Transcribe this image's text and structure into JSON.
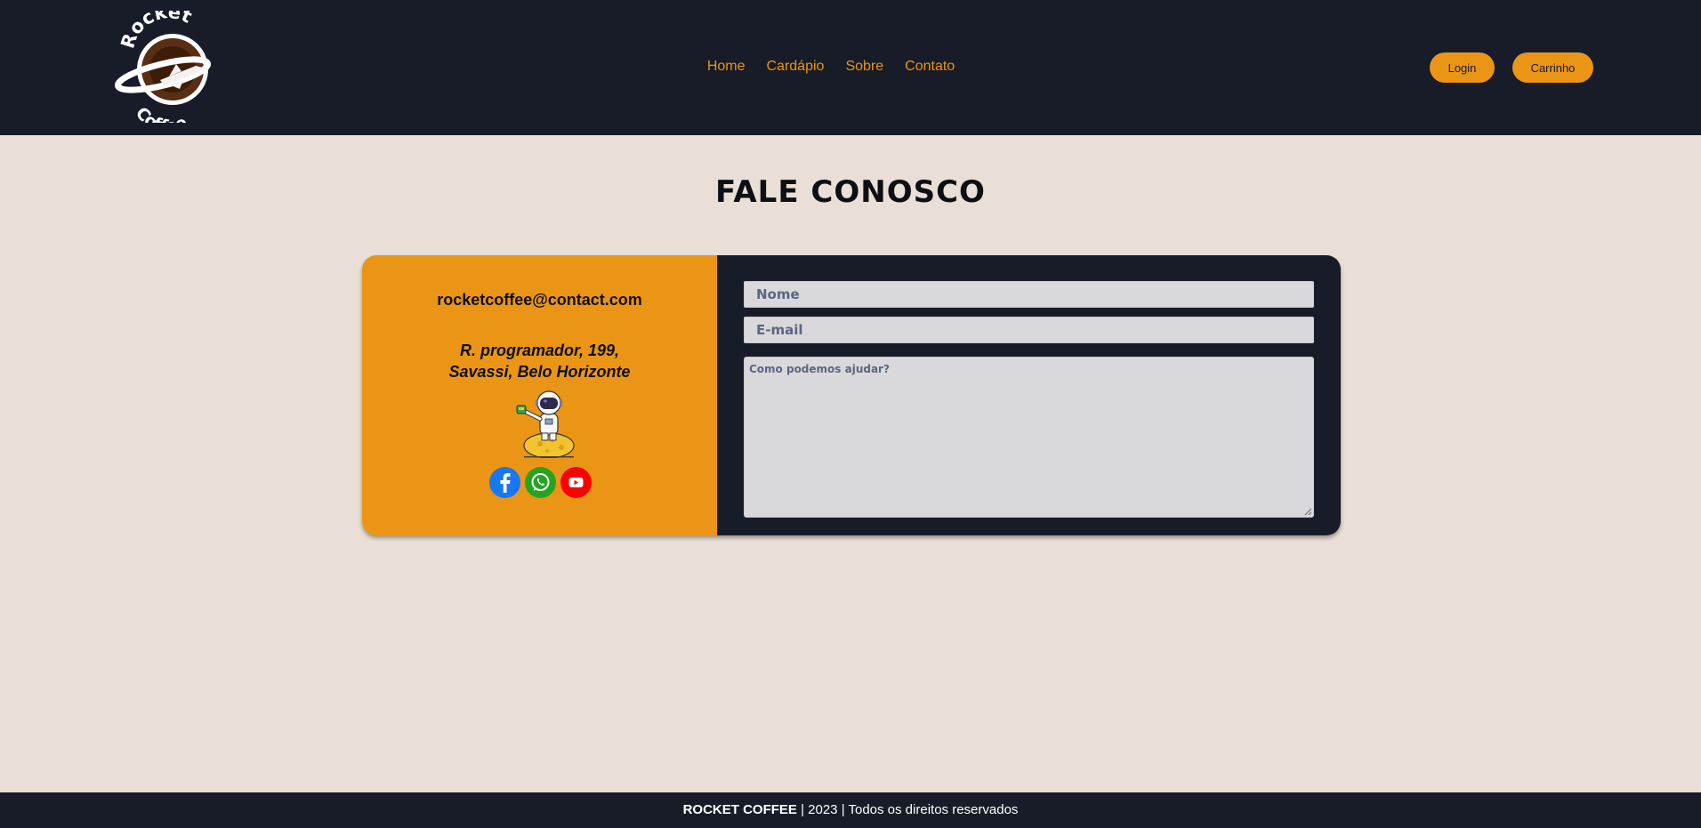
{
  "header": {
    "logo": {
      "top_text": "Rocket",
      "bottom_text": "Coffee",
      "icon": "rocket-coffee-cup-logo"
    },
    "nav": [
      {
        "label": "Home"
      },
      {
        "label": "Cardápio"
      },
      {
        "label": "Sobre"
      },
      {
        "label": "Contato"
      }
    ],
    "login_label": "Login",
    "cart_label": "Carrinho"
  },
  "main": {
    "title": "FALE CONOSCO",
    "contact": {
      "email": "rocketcoffee@contact.com",
      "address_line1": "R. programador, 199,",
      "address_line2": "Savassi, Belo Horizonte",
      "illustration": "astronaut-on-moon-with-coffee",
      "socials": [
        {
          "icon": "facebook-icon",
          "color": "#1877f2"
        },
        {
          "icon": "whatsapp-icon",
          "color": "#25a51f"
        },
        {
          "icon": "youtube-icon",
          "color": "#ff0000"
        }
      ]
    },
    "form": {
      "name_placeholder": "Nome",
      "email_placeholder": "E-mail",
      "message_placeholder": "Como podemos ajudar?"
    }
  },
  "footer": {
    "brand": "ROCKET COFFEE",
    "rest": " | 2023 | Todos os direitos reservados"
  },
  "colors": {
    "dark": "#181c28",
    "accent": "#eb9516",
    "background": "#eadfd6",
    "field": "#d9d9db",
    "placeholder": "#5a6683"
  }
}
